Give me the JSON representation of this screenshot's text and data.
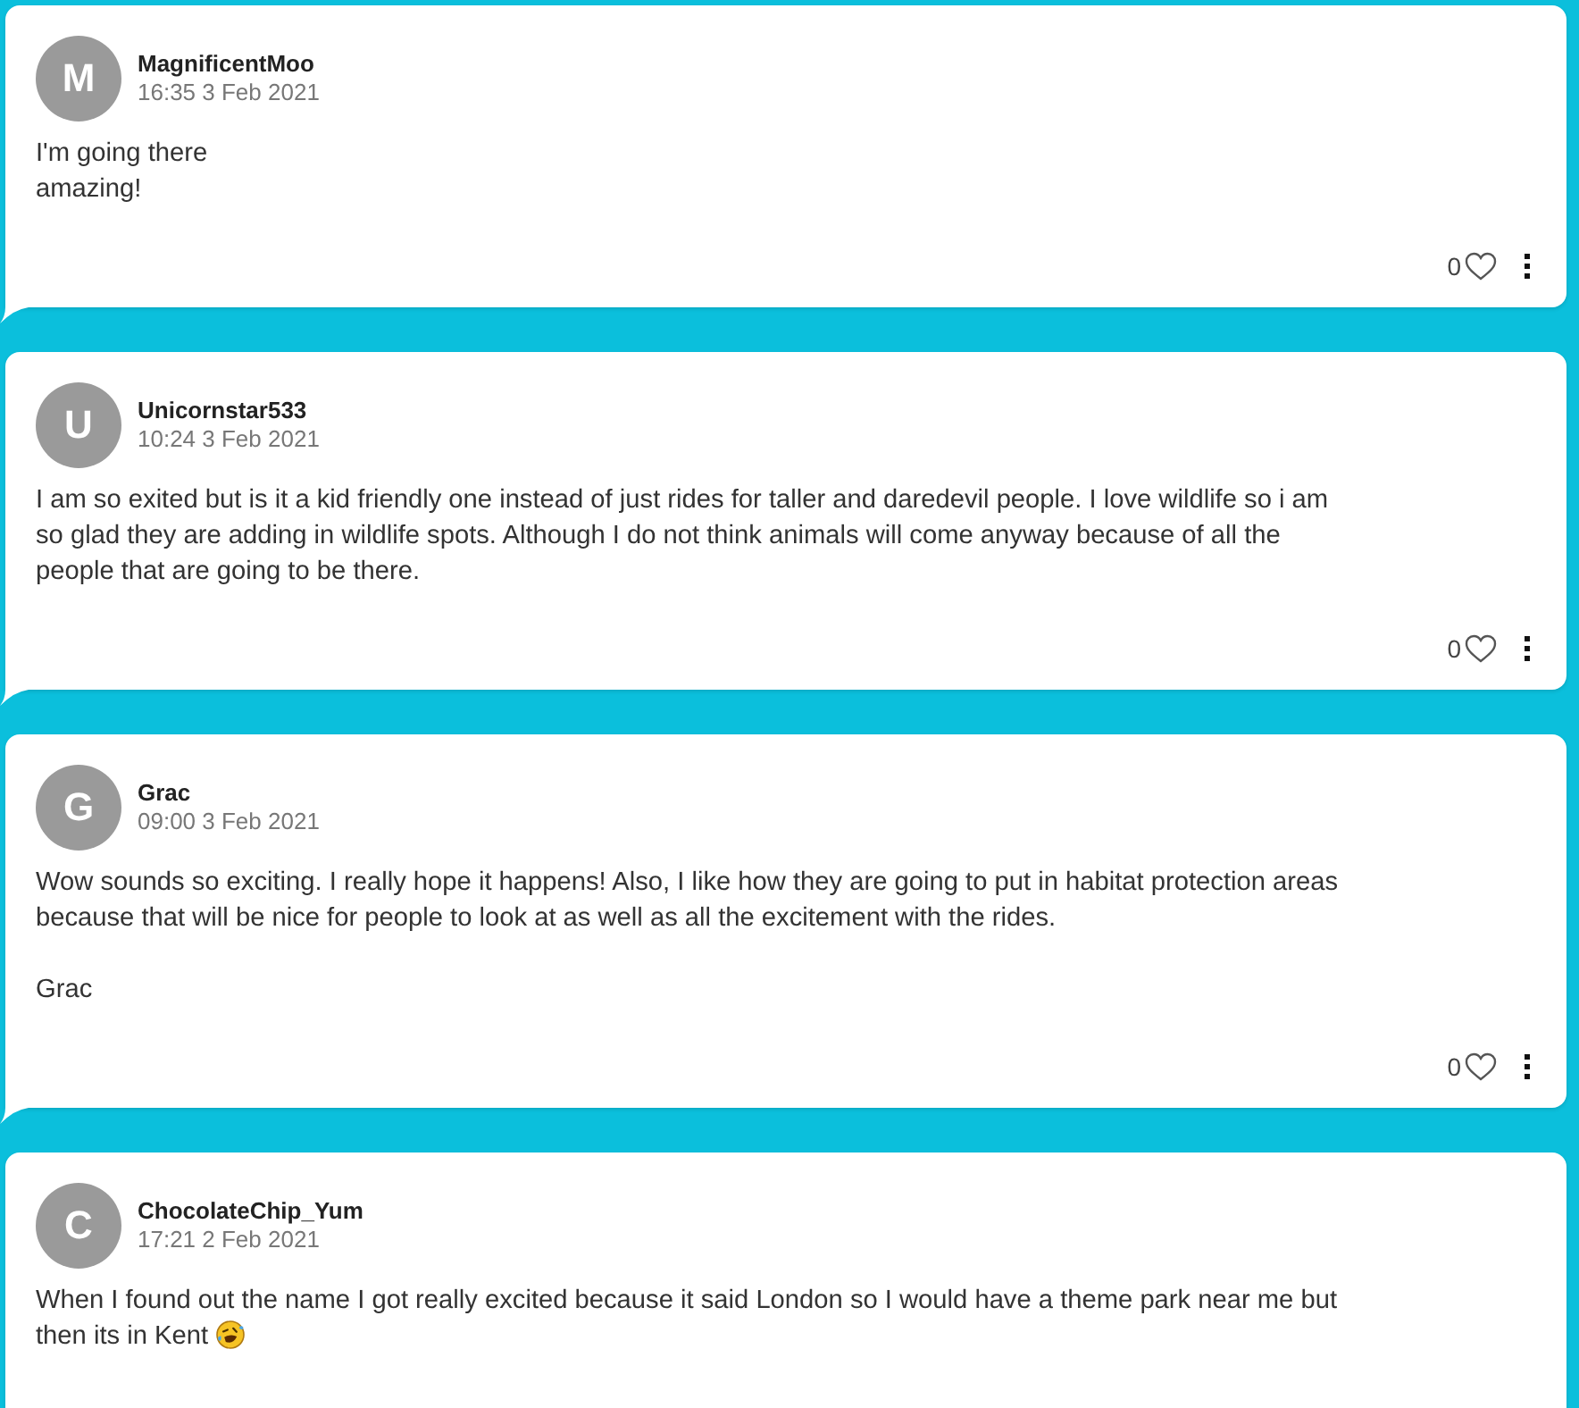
{
  "comments": [
    {
      "avatar_letter": "M",
      "username": "MagnificentMoo",
      "timestamp": "16:35 3 Feb 2021",
      "text": "I'm going there\namazing!",
      "emoji": false,
      "likes": "0",
      "liked": false
    },
    {
      "avatar_letter": "U",
      "username": "Unicornstar533",
      "timestamp": "10:24 3 Feb 2021",
      "text": "I am so exited but is it a kid friendly one instead of just rides for taller and daredevil people. I love wildlife so i am\nso glad they are adding in wildlife spots. Although I do not think animals will come anyway because of all the\npeople that are going to be there.",
      "emoji": false,
      "likes": "0",
      "liked": false
    },
    {
      "avatar_letter": "G",
      "username": "Grac",
      "timestamp": "09:00 3 Feb 2021",
      "text": "Wow sounds so exciting. I really hope it happens! Also, I like how they are going to put in habitat protection areas\nbecause that will be nice for people to look at as well as all the excitement with the rides.\n\nGrac",
      "emoji": false,
      "likes": "0",
      "liked": false
    },
    {
      "avatar_letter": "C",
      "username": "ChocolateChip_Yum",
      "timestamp": "17:21 2 Feb 2021",
      "text": "When I found out the name I got really excited because it said London so I would have a theme park near me but\nthen its in Kent",
      "emoji": true
    }
  ]
}
